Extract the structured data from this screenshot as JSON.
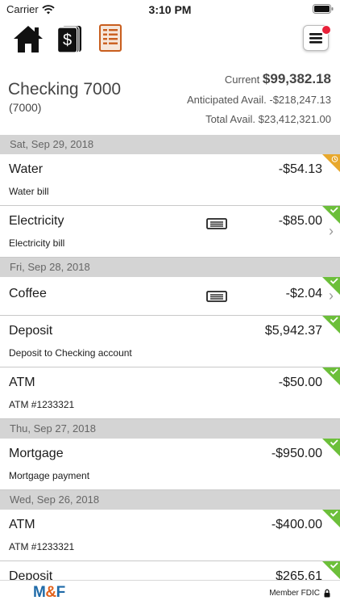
{
  "status_bar": {
    "carrier": "Carrier",
    "time": "3:10 PM"
  },
  "account": {
    "name": "Checking 7000",
    "number": "(7000)"
  },
  "balances": {
    "current_label": "Current",
    "current_value": "$99,382.18",
    "anticipated_label": "Anticipated Avail.",
    "anticipated_value": "-$218,247.13",
    "total_label": "Total Avail.",
    "total_value": "$23,412,321.00"
  },
  "groups": [
    {
      "date": "Sat, Sep 29, 2018",
      "items": [
        {
          "name": "Water",
          "memo": "Water bill",
          "amount": "-$54.13",
          "flag": "pending",
          "receipt": false,
          "chevron": false
        },
        {
          "name": "Electricity",
          "memo": "Electricity bill",
          "amount": "-$85.00",
          "flag": "cleared",
          "receipt": true,
          "chevron": true
        }
      ]
    },
    {
      "date": "Fri, Sep 28, 2018",
      "items": [
        {
          "name": "Coffee",
          "memo": "",
          "amount": "-$2.04",
          "flag": "cleared",
          "receipt": true,
          "chevron": true
        },
        {
          "name": "Deposit",
          "memo": "Deposit to Checking account",
          "amount": "$5,942.37",
          "flag": "cleared",
          "receipt": false,
          "chevron": false
        },
        {
          "name": "ATM",
          "memo": "ATM #1233321",
          "amount": "-$50.00",
          "flag": "cleared",
          "receipt": false,
          "chevron": false
        }
      ]
    },
    {
      "date": "Thu, Sep 27, 2018",
      "items": [
        {
          "name": "Mortgage",
          "memo": "Mortgage payment",
          "amount": "-$950.00",
          "flag": "cleared",
          "receipt": false,
          "chevron": false
        }
      ]
    },
    {
      "date": "Wed, Sep 26, 2018",
      "items": [
        {
          "name": "ATM",
          "memo": "ATM #1233321",
          "amount": "-$400.00",
          "flag": "cleared",
          "receipt": false,
          "chevron": false
        },
        {
          "name": "Deposit",
          "memo": "",
          "amount": "$265.61",
          "flag": "cleared",
          "receipt": false,
          "chevron": false
        }
      ]
    }
  ],
  "footer": {
    "logo_m": "M",
    "logo_amp": "&",
    "logo_f": "F",
    "fdic": "Member FDIC"
  },
  "colors": {
    "cleared": "#6cbf3a",
    "pending": "#e8a82d",
    "brand_blue": "#1f6aa8",
    "brand_orange": "#e2621c"
  },
  "icons": [
    "home-icon",
    "cash-icon",
    "ledger-icon",
    "hamburger-menu-icon",
    "receipt-icon",
    "chevron-right-icon",
    "cleared-check-flag-icon",
    "pending-clock-flag-icon",
    "lock-icon"
  ]
}
